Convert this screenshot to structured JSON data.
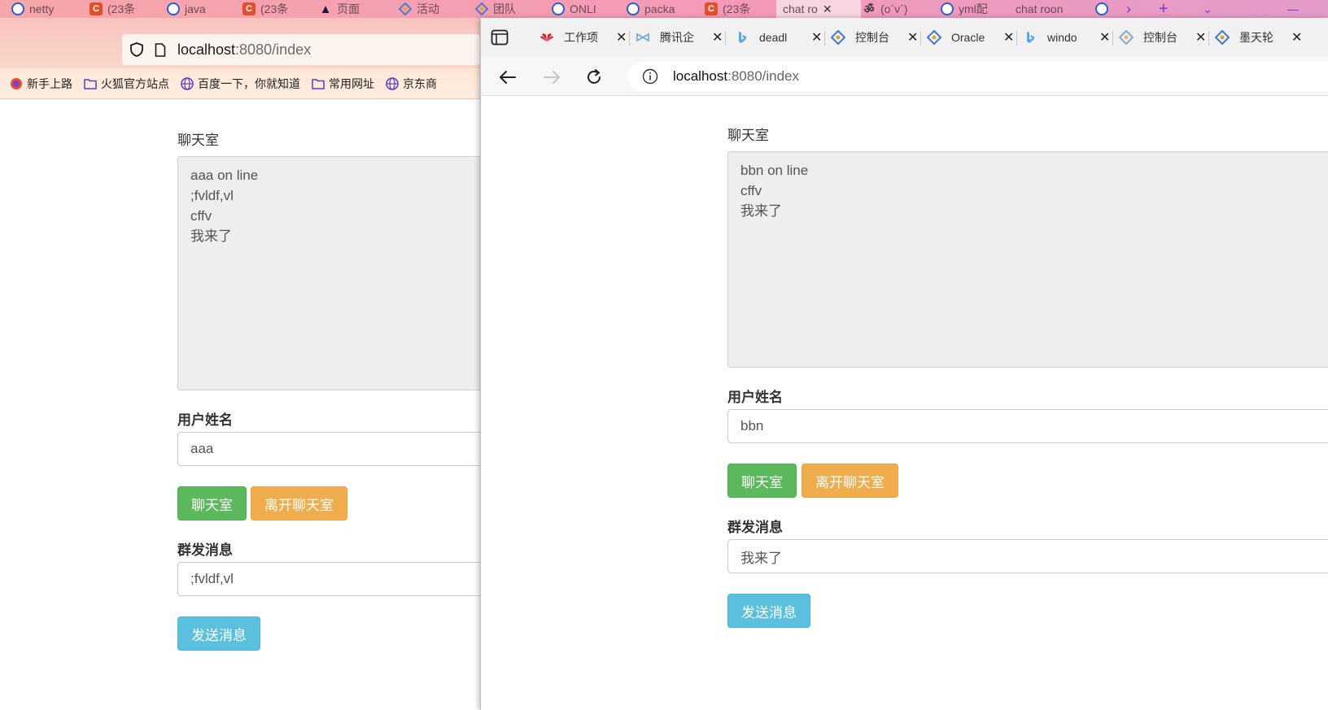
{
  "firefox": {
    "tabs": [
      {
        "title": "netty",
        "icon": "baidu-paw-icon"
      },
      {
        "title": "(23条",
        "icon": "csdn-icon"
      },
      {
        "title": "java",
        "icon": "baidu-paw-icon"
      },
      {
        "title": "(23条",
        "icon": "csdn-icon"
      },
      {
        "title": "页面",
        "icon": "warning-icon"
      },
      {
        "title": "活动",
        "icon": "app-icon"
      },
      {
        "title": "团队",
        "icon": "app-icon"
      },
      {
        "title": "ONLI",
        "icon": "baidu-paw-icon"
      },
      {
        "title": "packa",
        "icon": "baidu-paw-icon"
      },
      {
        "title": "(23条",
        "icon": "csdn-icon"
      },
      {
        "title": "chat ro",
        "icon": "page-icon",
        "active": true
      },
      {
        "title": "(o´v`)",
        "icon": "app-icon"
      },
      {
        "title": "yml配",
        "icon": "baidu-paw-icon"
      },
      {
        "title": "chat roon",
        "icon": "page-icon"
      }
    ],
    "url_host": "localhost",
    "url_path": ":8080/index",
    "bookmarks": [
      {
        "label": "新手上路",
        "icon": "firefox-icon"
      },
      {
        "label": "火狐官方站点",
        "icon": "folder-icon"
      },
      {
        "label": "百度一下，你就知道",
        "icon": "globe-icon"
      },
      {
        "label": "常用网址",
        "icon": "folder-icon"
      },
      {
        "label": "京东商",
        "icon": "globe-icon"
      }
    ],
    "chat": {
      "title": "聊天室",
      "messages": [
        "aaa on line",
        ";fvldf,vl",
        "cffv",
        "我来了"
      ],
      "username_label": "用户姓名",
      "username_value": "aaa",
      "join_label": "聊天室",
      "leave_label": "离开聊天室",
      "broadcast_label": "群发消息",
      "broadcast_value": ";fvldf,vl",
      "send_label": "发送消息"
    }
  },
  "edge": {
    "tabs": [
      {
        "title": "工作项",
        "icon": "huawei-icon"
      },
      {
        "title": "腾讯企",
        "icon": "tencent-icon"
      },
      {
        "title": "deadl",
        "icon": "bing-icon"
      },
      {
        "title": "控制台",
        "icon": "app-icon"
      },
      {
        "title": "Oracle",
        "icon": "app-icon"
      },
      {
        "title": "windo",
        "icon": "bing-icon"
      },
      {
        "title": "控制台",
        "icon": "app-icon"
      },
      {
        "title": "墨天轮",
        "icon": "app-icon"
      }
    ],
    "url_host": "localhost",
    "url_path": ":8080/index",
    "chat": {
      "title": "聊天室",
      "messages": [
        "bbn on line",
        "cffv",
        "我来了"
      ],
      "username_label": "用户姓名",
      "username_value": "bbn",
      "join_label": "聊天室",
      "leave_label": "离开聊天室",
      "broadcast_label": "群发消息",
      "broadcast_value": "我来了",
      "send_label": "发送消息"
    }
  },
  "colors": {
    "success": "#5cb85c",
    "warning": "#f0ad4e",
    "info": "#5bc0de"
  }
}
